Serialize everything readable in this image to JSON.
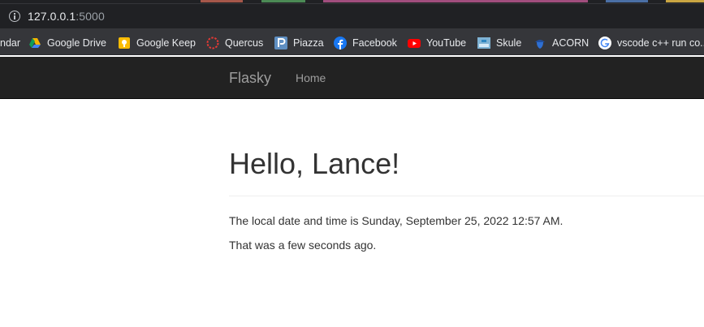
{
  "browser": {
    "url_host": "127.0.0.1",
    "url_port": ":5000"
  },
  "bookmarks": [
    {
      "label": "ndar",
      "icon": "calendar-icon"
    },
    {
      "label": "Google Drive",
      "icon": "google-drive-icon"
    },
    {
      "label": "Google Keep",
      "icon": "google-keep-icon"
    },
    {
      "label": "Quercus",
      "icon": "quercus-icon"
    },
    {
      "label": "Piazza",
      "icon": "piazza-icon"
    },
    {
      "label": "Facebook",
      "icon": "facebook-icon"
    },
    {
      "label": "YouTube",
      "icon": "youtube-icon"
    },
    {
      "label": "Skule",
      "icon": "skule-icon"
    },
    {
      "label": "ACORN",
      "icon": "acorn-icon"
    },
    {
      "label": "vscode c++ run co...",
      "icon": "google-icon"
    }
  ],
  "navbar": {
    "brand": "Flasky",
    "home": "Home"
  },
  "content": {
    "heading": "Hello, Lance!",
    "datetime_text": "The local date and time is Sunday, September 25, 2022 12:57 AM.",
    "relative_text": "That was a few seconds ago."
  },
  "colors": {
    "navbar_bg": "#222222",
    "navbar_text": "#9d9d9d",
    "browser_bg": "#35363a",
    "body_text": "#333333"
  }
}
